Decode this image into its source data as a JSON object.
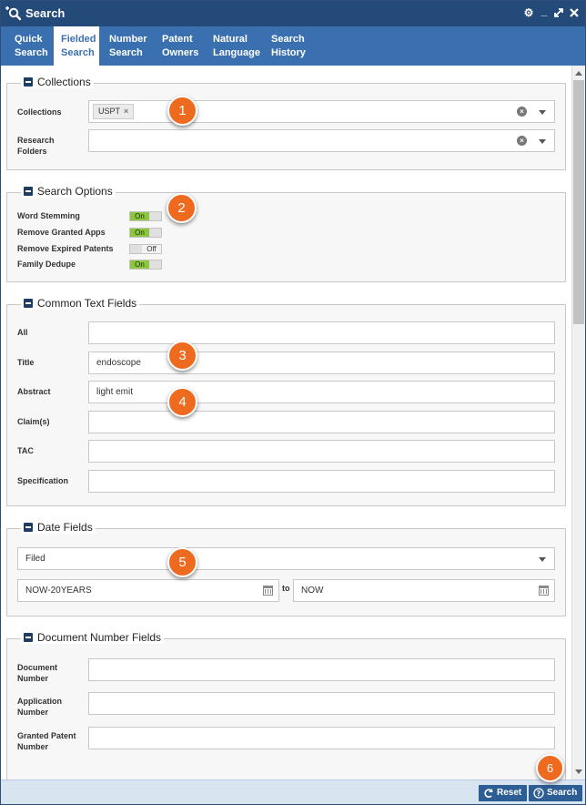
{
  "window": {
    "title": "Search"
  },
  "tabs": [
    {
      "line1": "Quick",
      "line2": "Search"
    },
    {
      "line1": "Fielded",
      "line2": "Search"
    },
    {
      "line1": "Number",
      "line2": "Search"
    },
    {
      "line1": "Patent",
      "line2": "Owners"
    },
    {
      "line1": "Natural",
      "line2": "Language"
    },
    {
      "line1": "Search",
      "line2": "History"
    }
  ],
  "active_tab": "Fielded Search",
  "collections": {
    "legend": "Collections",
    "collections_label": "Collections",
    "chip": "USPT",
    "folders_label_1": "Research",
    "folders_label_2": "Folders"
  },
  "search_options": {
    "legend": "Search Options",
    "items": [
      {
        "label": "Word Stemming",
        "state": "On"
      },
      {
        "label": "Remove Granted Apps",
        "state": "On"
      },
      {
        "label": "Remove Expired Patents",
        "state": "Off"
      },
      {
        "label": "Family Dedupe",
        "state": "On"
      }
    ]
  },
  "text_fields": {
    "legend": "Common Text Fields",
    "fields": [
      {
        "label": "All",
        "value": ""
      },
      {
        "label": "Title",
        "value": "endoscope"
      },
      {
        "label": "Abstract",
        "value": "light emit"
      },
      {
        "label": "Claim(s)",
        "value": ""
      },
      {
        "label": "TAC",
        "value": ""
      },
      {
        "label": "Specification",
        "value": ""
      }
    ]
  },
  "date_fields": {
    "legend": "Date Fields",
    "type": "Filed",
    "from": "NOW-20YEARS",
    "to_label": "to",
    "to": "NOW"
  },
  "doc_fields": {
    "legend": "Document Number Fields",
    "fields": [
      {
        "label1": "Document",
        "label2": "Number"
      },
      {
        "label1": "Application",
        "label2": "Number"
      },
      {
        "label1": "Granted Patent",
        "label2": "Number"
      }
    ]
  },
  "buttons": {
    "reset": "Reset",
    "search": "Search"
  },
  "badges": [
    "1",
    "2",
    "3",
    "4",
    "5",
    "6"
  ],
  "colors": {
    "titlebar": "#244a7a",
    "tabbar": "#3b70b0",
    "badge": "#ee6a1f",
    "toggle_on": "#8cc63f"
  }
}
